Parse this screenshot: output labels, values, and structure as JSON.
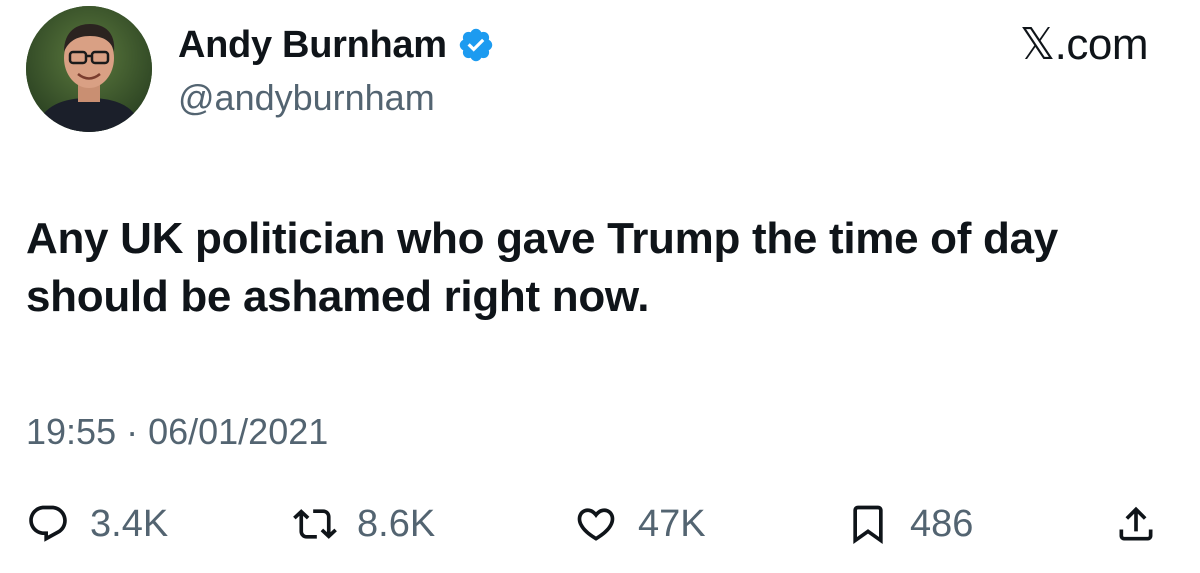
{
  "author": {
    "display_name": "Andy Burnham",
    "handle": "@andyburnham",
    "verified": true,
    "verified_color": "#1d9bf0"
  },
  "brand": {
    "label": "𝕏.com"
  },
  "tweet": {
    "text": "Any UK politician who gave Trump the time of day should be ashamed right now.",
    "timestamp": "19:55 · 06/01/2021"
  },
  "actions": {
    "reply": {
      "icon": "reply-icon",
      "count": "3.4K"
    },
    "repost": {
      "icon": "repost-icon",
      "count": "8.6K"
    },
    "like": {
      "icon": "heart-icon",
      "count": "47K"
    },
    "bookmark": {
      "icon": "bookmark-icon",
      "count": "486"
    },
    "share": {
      "icon": "share-icon"
    }
  },
  "colors": {
    "text_primary": "#0f1419",
    "text_secondary": "#536471"
  }
}
